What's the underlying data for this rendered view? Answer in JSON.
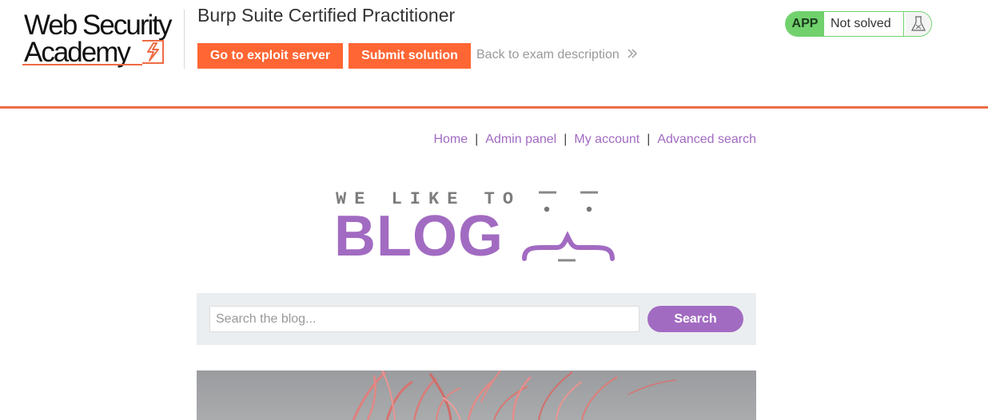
{
  "header": {
    "logo": {
      "line1": "Web Security",
      "line2": "Academy"
    },
    "exam_title": "Burp Suite Certified Practitioner",
    "buttons": {
      "exploit_server": "Go to exploit server",
      "submit_solution": "Submit solution"
    },
    "back_link": "Back to exam description",
    "status": {
      "badge": "APP",
      "text": "Not solved"
    }
  },
  "nav": {
    "items": [
      "Home",
      "Admin panel",
      "My account",
      "Advanced search"
    ],
    "separator": "|"
  },
  "blog_logo": {
    "tagline": "WE LIKE TO",
    "word": "BLOG"
  },
  "search": {
    "placeholder": "Search the blog...",
    "value": "",
    "button": "Search"
  },
  "colors": {
    "accent_orange": "#ff6633",
    "header_rule": "#ee6c45",
    "purple": "#a26bc2",
    "status_green": "#70d16d",
    "search_bg": "#ebeef0"
  },
  "icons": [
    "chevron-double-right-icon",
    "flask-icon",
    "lightning-icon"
  ]
}
